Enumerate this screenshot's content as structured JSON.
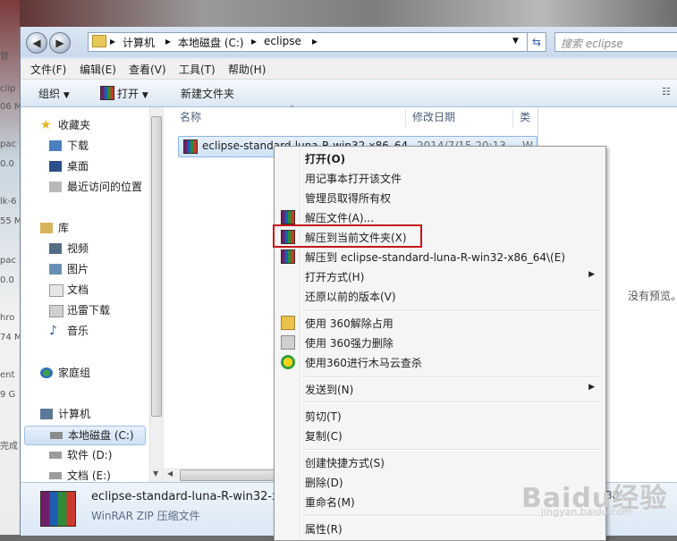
{
  "background_text": [
    "管",
    "clip",
    "06 M",
    "pac",
    "0.0",
    "lk-6",
    "55 M",
    "pac",
    "0.0",
    "hro",
    "74 M",
    "ent",
    "9 G",
    "完成"
  ],
  "address": {
    "crumbs": [
      "计算机",
      "本地磁盘 (C:)",
      "eclipse"
    ],
    "search_placeholder": "搜索 eclipse"
  },
  "menubar": [
    "文件(F)",
    "编辑(E)",
    "查看(V)",
    "工具(T)",
    "帮助(H)"
  ],
  "toolbar": {
    "organize": "组织",
    "open": "打开",
    "new_folder": "新建文件夹"
  },
  "navpane": {
    "favorites": {
      "label": "收藏夹",
      "items": [
        "下载",
        "桌面",
        "最近访问的位置"
      ]
    },
    "libraries": {
      "label": "库",
      "items": [
        "视频",
        "图片",
        "文档",
        "迅雷下载",
        "音乐"
      ]
    },
    "homegroup": "家庭组",
    "computer": {
      "label": "计算机",
      "items": [
        "本地磁盘 (C:)",
        "软件 (D:)",
        "文档 (E:)"
      ]
    }
  },
  "columns": {
    "name": "名称",
    "modified": "修改日期",
    "type": "类"
  },
  "file": {
    "name": "eclipse-standard-luna-R-win32-x86_64",
    "date": "2014/7/15 20:13",
    "type": "W"
  },
  "preview_text": "没有预览。",
  "details": {
    "name": "eclipse-standard-luna-R-win32-x",
    "type": "WinRAR ZIP 压缩文件",
    "size_fragment": "38"
  },
  "context_menu": {
    "open": "打开(O)",
    "open_notepad": "用记事本打开该文件",
    "take_ownership": "管理员取得所有权",
    "extract_files": "解压文件(A)...",
    "extract_here": "解压到当前文件夹(X)",
    "extract_to": "解压到 eclipse-standard-luna-R-win32-x86_64\\(E)",
    "open_with": "打开方式(H)",
    "restore": "还原以前的版本(V)",
    "unlock_360": "使用 360解除占用",
    "force_delete_360": "使用 360强力删除",
    "scan_360": "使用360进行木马云查杀",
    "send_to": "发送到(N)",
    "cut": "剪切(T)",
    "copy": "复制(C)",
    "create_shortcut": "创建快捷方式(S)",
    "delete": "删除(D)",
    "rename": "重命名(M)",
    "properties": "属性(R)"
  },
  "watermark": {
    "text": "Baidu经验",
    "sub": "jingyan.baidu.com"
  }
}
